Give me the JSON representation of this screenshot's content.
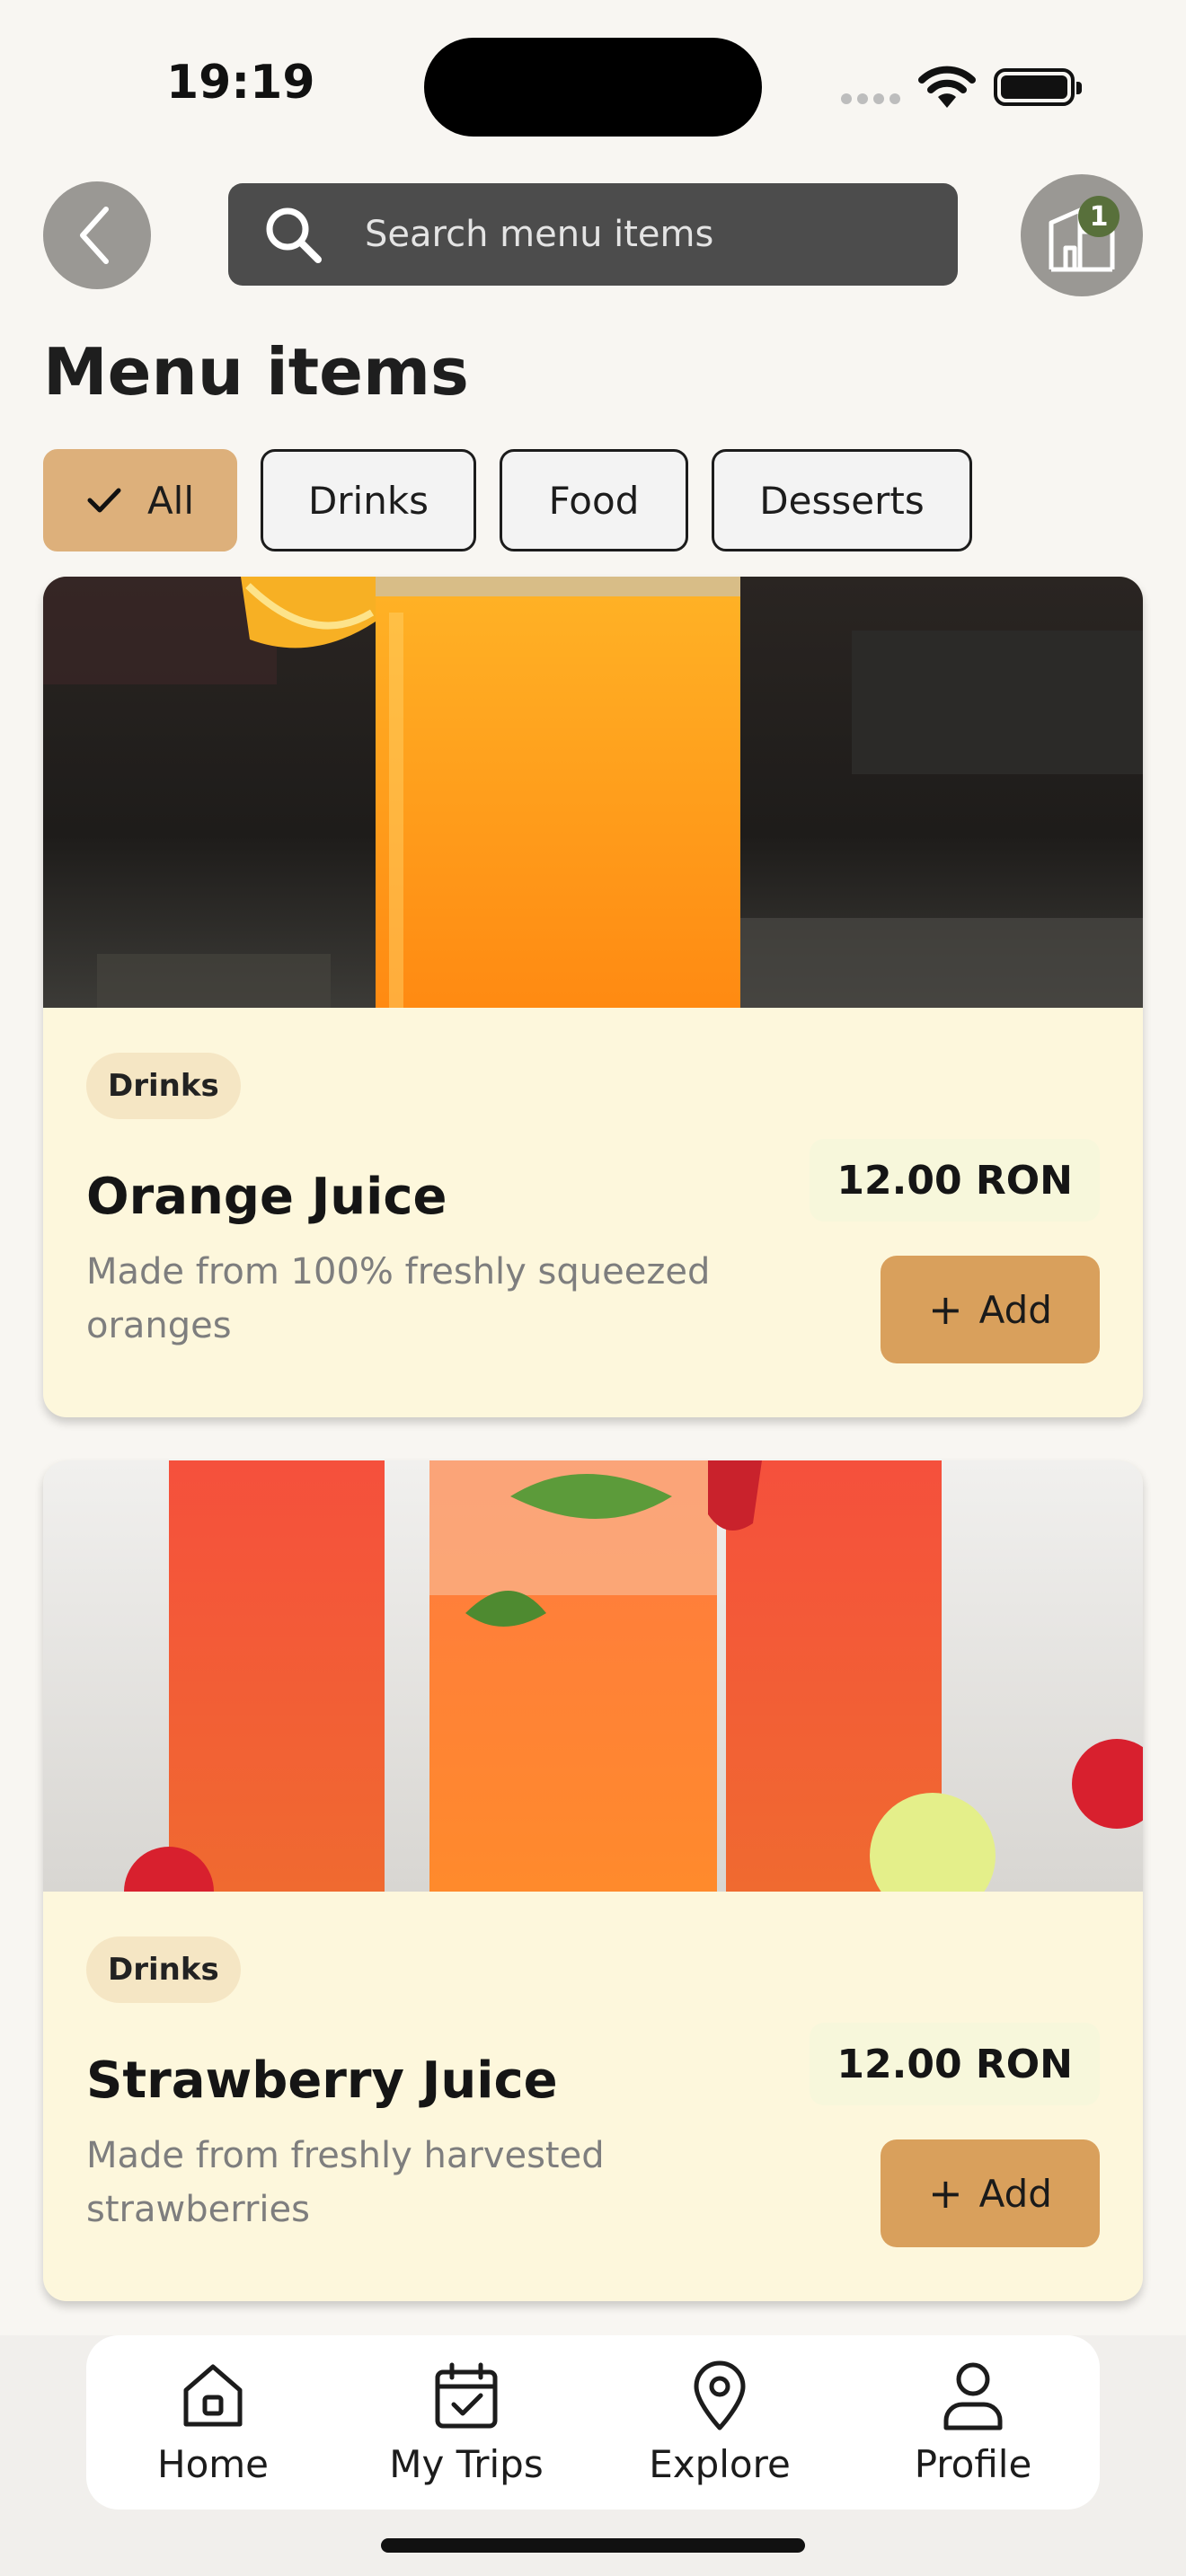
{
  "status_bar": {
    "time": "19:19"
  },
  "header": {
    "search_placeholder": "Search menu items",
    "venue_badge_count": "1",
    "icons": {
      "back": "chevron-left-icon",
      "search": "search-icon",
      "venue": "building-icon"
    }
  },
  "page_title": "Menu items",
  "filters": [
    {
      "label": "All",
      "selected": true
    },
    {
      "label": "Drinks",
      "selected": false
    },
    {
      "label": "Food",
      "selected": false
    },
    {
      "label": "Desserts",
      "selected": false
    }
  ],
  "items": [
    {
      "tag": "Drinks",
      "name": "Orange Juice",
      "description": "Made from 100% freshly squeezed oranges",
      "price": "12.00 RON",
      "add_label": "Add"
    },
    {
      "tag": "Drinks",
      "name": "Strawberry Juice",
      "description": "Made from freshly harvested strawberries",
      "price": "12.00 RON",
      "add_label": "Add"
    }
  ],
  "bottom_nav": [
    {
      "label": "Home",
      "icon": "home-icon"
    },
    {
      "label": "My Trips",
      "icon": "calendar-icon"
    },
    {
      "label": "Explore",
      "icon": "map-pin-icon"
    },
    {
      "label": "Profile",
      "icon": "user-icon"
    }
  ],
  "colors": {
    "accent": "#ddb07b",
    "add_button": "#d9a05c",
    "card_background": "#fdf7dc",
    "badge": "#58703b",
    "search_background": "#4c4c4c"
  }
}
